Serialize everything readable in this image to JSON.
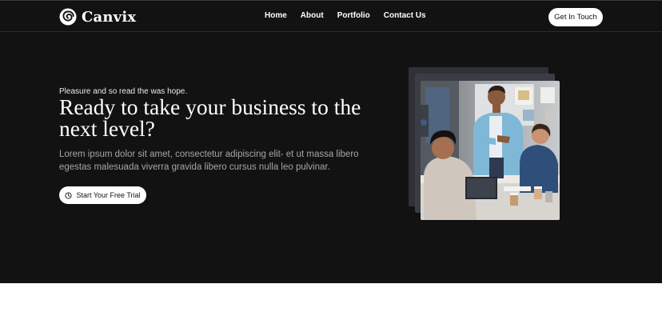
{
  "brand": {
    "name": "Canvix",
    "logo_icon": "swirl-logo-icon"
  },
  "nav": {
    "items": [
      {
        "label": "Home"
      },
      {
        "label": "About"
      },
      {
        "label": "Portfolio"
      },
      {
        "label": "Contact Us"
      }
    ],
    "cta_label": "Get In Touch"
  },
  "hero": {
    "eyebrow": "Pleasure and so read the was hope.",
    "headline": "Ready to take your business to the next level?",
    "lede": "Lorem ipsum dolor sit amet, consectetur adipiscing elit- et ut massa libero egestas malesuada viverra gravida libero cursus nulla leo pulvinar.",
    "cta_label": "Start Your Free Trial",
    "cta_icon": "clock-icon"
  },
  "colors": {
    "hero_bg": "#121212",
    "page_bg": "#ffffff",
    "text_primary": "#ffffff",
    "text_muted": "#a7a7ab",
    "button_bg": "#ffffff",
    "button_text": "#121212"
  }
}
